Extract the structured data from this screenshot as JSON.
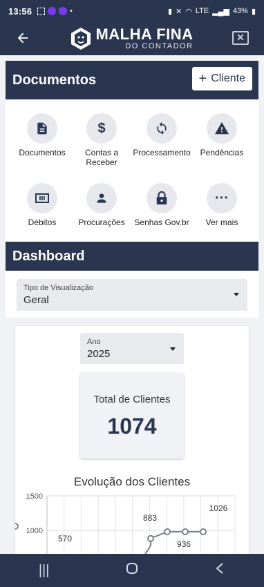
{
  "status_bar": {
    "time": "13:56",
    "battery": "43%",
    "network": "LTE"
  },
  "header": {
    "logo_line1": "MALHA FINA",
    "logo_line2": "DO CONTADOR",
    "back_icon": "arrow-left-icon",
    "close_icon": "close-box-icon"
  },
  "documentos": {
    "title": "Documentos",
    "add_button": "Cliente",
    "tiles": [
      {
        "label": "Documentos",
        "icon": "document-icon"
      },
      {
        "label": "Contas a Receber",
        "icon": "dollar-icon"
      },
      {
        "label": "Processamento",
        "icon": "sync-icon"
      },
      {
        "label": "Pendências",
        "icon": "warning-icon"
      },
      {
        "label": "Débitos",
        "icon": "debit-icon"
      },
      {
        "label": "Procurações",
        "icon": "person-icon"
      },
      {
        "label": "Senhas Gov.br",
        "icon": "lock-icon"
      },
      {
        "label": "Ver mais",
        "icon": "more-icon"
      }
    ]
  },
  "dashboard": {
    "title": "Dashboard",
    "view_type": {
      "caption": "Tipo de Visualização",
      "value": "Geral"
    },
    "year": {
      "caption": "Ano",
      "value": "2025"
    },
    "total": {
      "label": "Total de Clientes",
      "value": "1074"
    },
    "chart_title": "Evolução dos Clientes"
  },
  "chart_data": {
    "type": "line",
    "title": "Evolução dos Clientes",
    "y_ticks": [
      1000,
      1500
    ],
    "ylim": [
      null,
      1500
    ],
    "visible_labels": [
      "570",
      "883",
      "936",
      "1026"
    ],
    "grid": true,
    "series": [
      {
        "values": [
          570,
          883,
          936,
          940,
          945,
          1026
        ]
      }
    ]
  },
  "nav": {
    "recent": "recent-apps-icon",
    "home": "home-icon",
    "back": "back-icon"
  }
}
